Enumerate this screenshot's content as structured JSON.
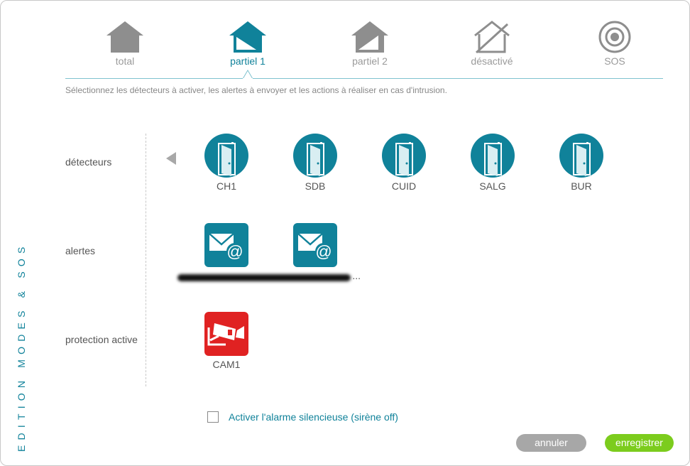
{
  "sidebar": {
    "title": "EDITION MODES & SOS"
  },
  "modes": [
    {
      "label": "total",
      "icon": "house-full-icon",
      "active": false
    },
    {
      "label": "partiel 1",
      "icon": "house-partial-1-icon",
      "active": true
    },
    {
      "label": "partiel 2",
      "icon": "house-partial-2-icon",
      "active": false
    },
    {
      "label": "désactivé",
      "icon": "house-disabled-icon",
      "active": false
    },
    {
      "label": "SOS",
      "icon": "sos-target-icon",
      "active": false
    }
  ],
  "instructions": "Sélectionnez les détecteurs à activer, les alertes à envoyer et les actions à réaliser en cas d'intrusion.",
  "sections": {
    "detectors": {
      "label": "détecteurs"
    },
    "alerts": {
      "label": "alertes"
    },
    "protection": {
      "label": "protection active"
    }
  },
  "detectors": [
    {
      "label": "CH1",
      "icon": "door-open-icon"
    },
    {
      "label": "SDB",
      "icon": "door-open-icon"
    },
    {
      "label": "CUID",
      "icon": "door-open-icon"
    },
    {
      "label": "SALG",
      "icon": "door-open-icon"
    },
    {
      "label": "BUR",
      "icon": "door-open-icon"
    }
  ],
  "alerts": [
    {
      "icon": "email-at-icon"
    },
    {
      "icon": "email-at-icon"
    }
  ],
  "alerts_caption_ellipsis": "...",
  "protection": [
    {
      "label": "CAM1",
      "icon": "camera-icon"
    }
  ],
  "silent_alarm": {
    "label": "Activer l'alarme silencieuse (sirène off)",
    "checked": false
  },
  "buttons": {
    "cancel": "annuler",
    "save": "enregistrer"
  },
  "colors": {
    "accent": "#10829a",
    "save": "#7ccc1d",
    "cancel": "#a7a7a7",
    "camera": "#e02222"
  }
}
